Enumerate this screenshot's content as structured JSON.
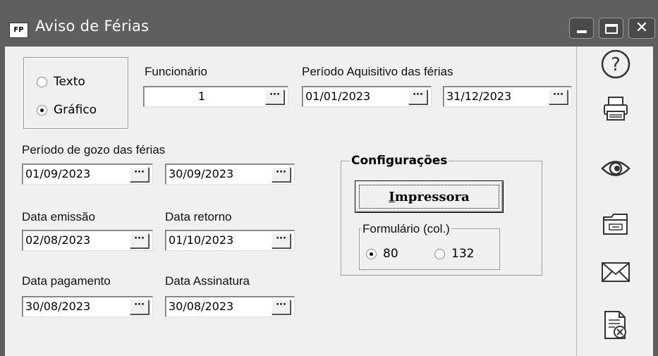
{
  "window": {
    "app_icon_text": "FP",
    "title": "Aviso de Férias",
    "controls": {
      "minimize": "minimize",
      "maximize": "maximize",
      "close": "✕"
    }
  },
  "output_type": {
    "options": [
      {
        "label": "Texto",
        "selected": false
      },
      {
        "label": "Gráfico",
        "selected": true
      }
    ]
  },
  "funcionario": {
    "label": "Funcionário",
    "value": "1",
    "button": "···"
  },
  "periodo_aquisitivo": {
    "label": "Período Aquisitivo das férias",
    "start": "01/01/2023",
    "end": "31/12/2023",
    "button": "···"
  },
  "periodo_gozo": {
    "label": "Período de gozo das férias",
    "start": "01/09/2023",
    "end": "30/09/2023",
    "button": "···"
  },
  "data_emissao": {
    "label": "Data emissão",
    "value": "02/08/2023",
    "button": "···"
  },
  "data_retorno": {
    "label": "Data retorno",
    "value": "01/10/2023",
    "button": "···"
  },
  "data_pagamento": {
    "label": "Data pagamento",
    "value": "30/08/2023",
    "button": "···"
  },
  "data_assinatura": {
    "label": "Data Assinatura",
    "value": "30/08/2023",
    "button": "···"
  },
  "configuracoes": {
    "title": "Configurações",
    "print_button": {
      "underlined": "I",
      "rest": "mpressora"
    },
    "formulario": {
      "title": "Formulário (col.)",
      "options": [
        {
          "label": "80",
          "selected": true
        },
        {
          "label": "132",
          "selected": false
        }
      ]
    }
  },
  "toolbar": {
    "items": [
      "help-icon",
      "printer-icon",
      "preview-icon",
      "folder-icon",
      "email-icon",
      "cancel-document-icon"
    ]
  }
}
